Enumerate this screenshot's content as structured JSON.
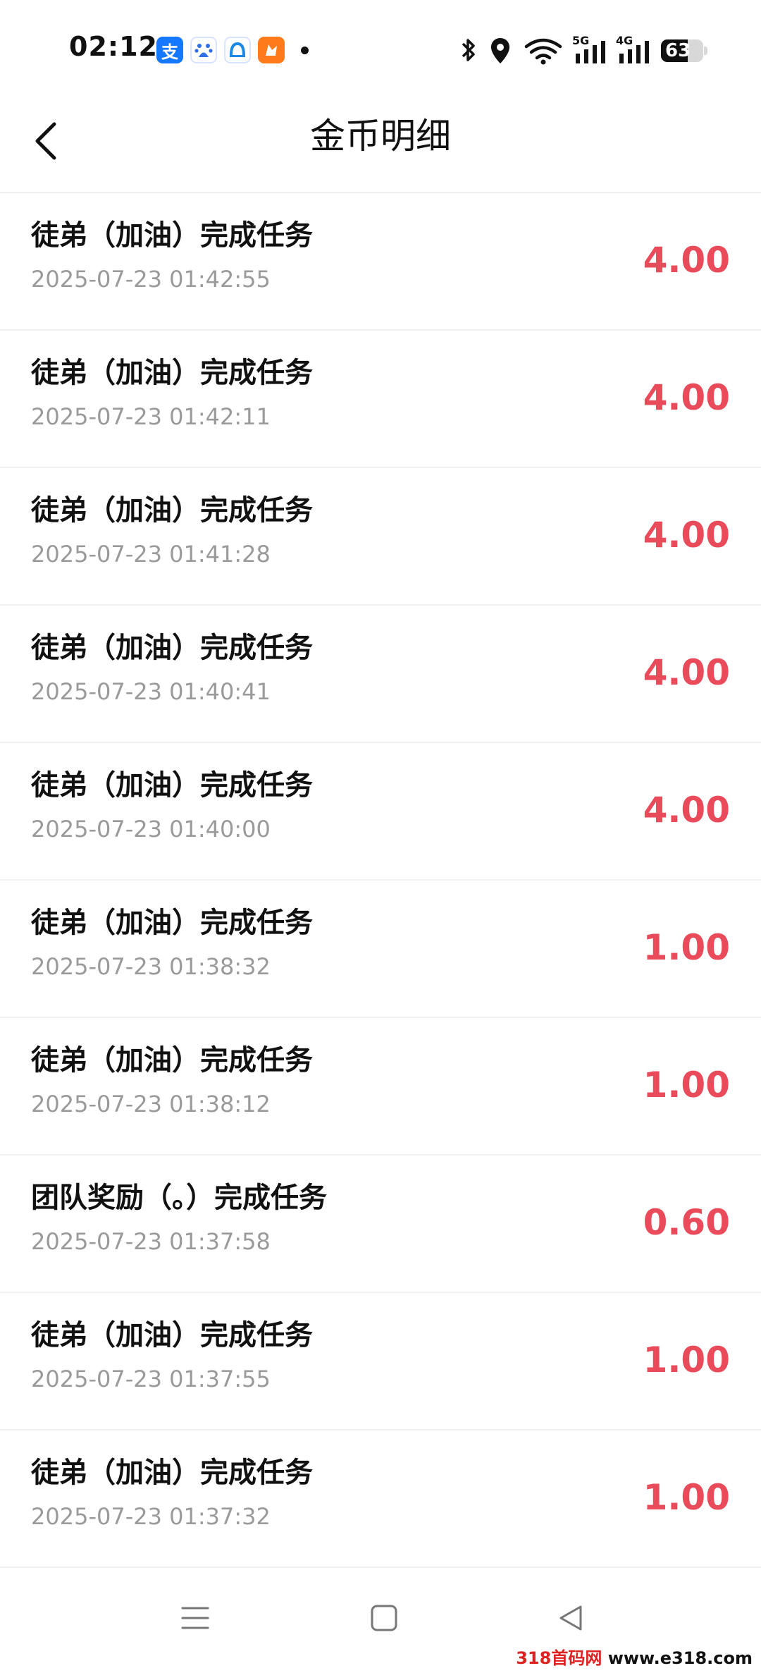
{
  "status_bar": {
    "time": "02:12",
    "alipay_glyph": "支",
    "network_1": "5G",
    "network_2": "4G",
    "battery_level": "63",
    "battery_percent": 63,
    "icons": [
      "alipay-icon",
      "baidu-icon",
      "maps-icon",
      "fox-app-icon",
      "bluetooth-icon",
      "location-icon",
      "wifi-icon",
      "signal-icon",
      "battery-icon"
    ]
  },
  "header": {
    "title": "金币明细",
    "back_icon": "chevron-left-icon"
  },
  "records": [
    {
      "title": "徒弟（加油）完成任务",
      "time": "2025-07-23 01:42:55",
      "amount": "4.00"
    },
    {
      "title": "徒弟（加油）完成任务",
      "time": "2025-07-23 01:42:11",
      "amount": "4.00"
    },
    {
      "title": "徒弟（加油）完成任务",
      "time": "2025-07-23 01:41:28",
      "amount": "4.00"
    },
    {
      "title": "徒弟（加油）完成任务",
      "time": "2025-07-23 01:40:41",
      "amount": "4.00"
    },
    {
      "title": "徒弟（加油）完成任务",
      "time": "2025-07-23 01:40:00",
      "amount": "4.00"
    },
    {
      "title": "徒弟（加油）完成任务",
      "time": "2025-07-23 01:38:32",
      "amount": "1.00"
    },
    {
      "title": "徒弟（加油）完成任务",
      "time": "2025-07-23 01:38:12",
      "amount": "1.00"
    },
    {
      "title": "团队奖励（。）完成任务",
      "time": "2025-07-23 01:37:58",
      "amount": "0.60"
    },
    {
      "title": "徒弟（加油）完成任务",
      "time": "2025-07-23 01:37:55",
      "amount": "1.00"
    },
    {
      "title": "徒弟（加油）完成任务",
      "time": "2025-07-23 01:37:32",
      "amount": "1.00"
    }
  ],
  "colors": {
    "amount": "#e94b5b",
    "time": "#9a9a9a",
    "title": "#111111",
    "divider": "#f0f0f0"
  },
  "nav_bar": {
    "icons": [
      "menu-icon",
      "home-square-icon",
      "back-triangle-icon"
    ]
  },
  "watermark": {
    "brand": "318首码网",
    "url": "www.e318.com"
  }
}
